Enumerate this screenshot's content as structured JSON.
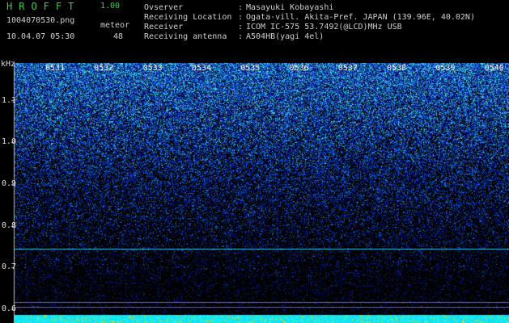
{
  "header": {
    "app_name": "HROFFT",
    "version": "1.00",
    "filename": "1004070530.png",
    "meteor_label": "meteor",
    "meteor_count": "48",
    "datetime": "10.04.07 05:30"
  },
  "info": [
    {
      "key": "Ovserver",
      "value": "Masayuki Kobayashi"
    },
    {
      "key": "Receiving Location",
      "value": "Ogata-vill. Akita-Pref. JAPAN (139.96E, 40.02N)"
    },
    {
      "key": "Receiver",
      "value": "ICOM IC-575 53.7492(@LCD)MHz USB"
    },
    {
      "key": "Receiving antenna",
      "value": "A504HB(yagi 4el)"
    }
  ],
  "spectrogram": {
    "y_unit": "kHz",
    "y_ticks": [
      "1.1",
      "1.0",
      "0.9",
      "0.8",
      "0.7",
      "0.6"
    ],
    "x_ticks": [
      "0531",
      "0532",
      "0533",
      "0534",
      "0535",
      "0536",
      "0537",
      "0538",
      "0539",
      "0540"
    ],
    "y_range_khz": [
      0.59,
      1.19
    ],
    "colors": {
      "background": "#000000",
      "noise_low": "#0a1a8a",
      "noise_mid": "#1e5fd8",
      "noise_high": "#33c8c8",
      "carrier_line": "#2fbfe6",
      "bottom_band": "#16e0ff"
    },
    "carrier_khz": 0.745,
    "reference_lines_khz": [
      0.617,
      0.605
    ]
  }
}
